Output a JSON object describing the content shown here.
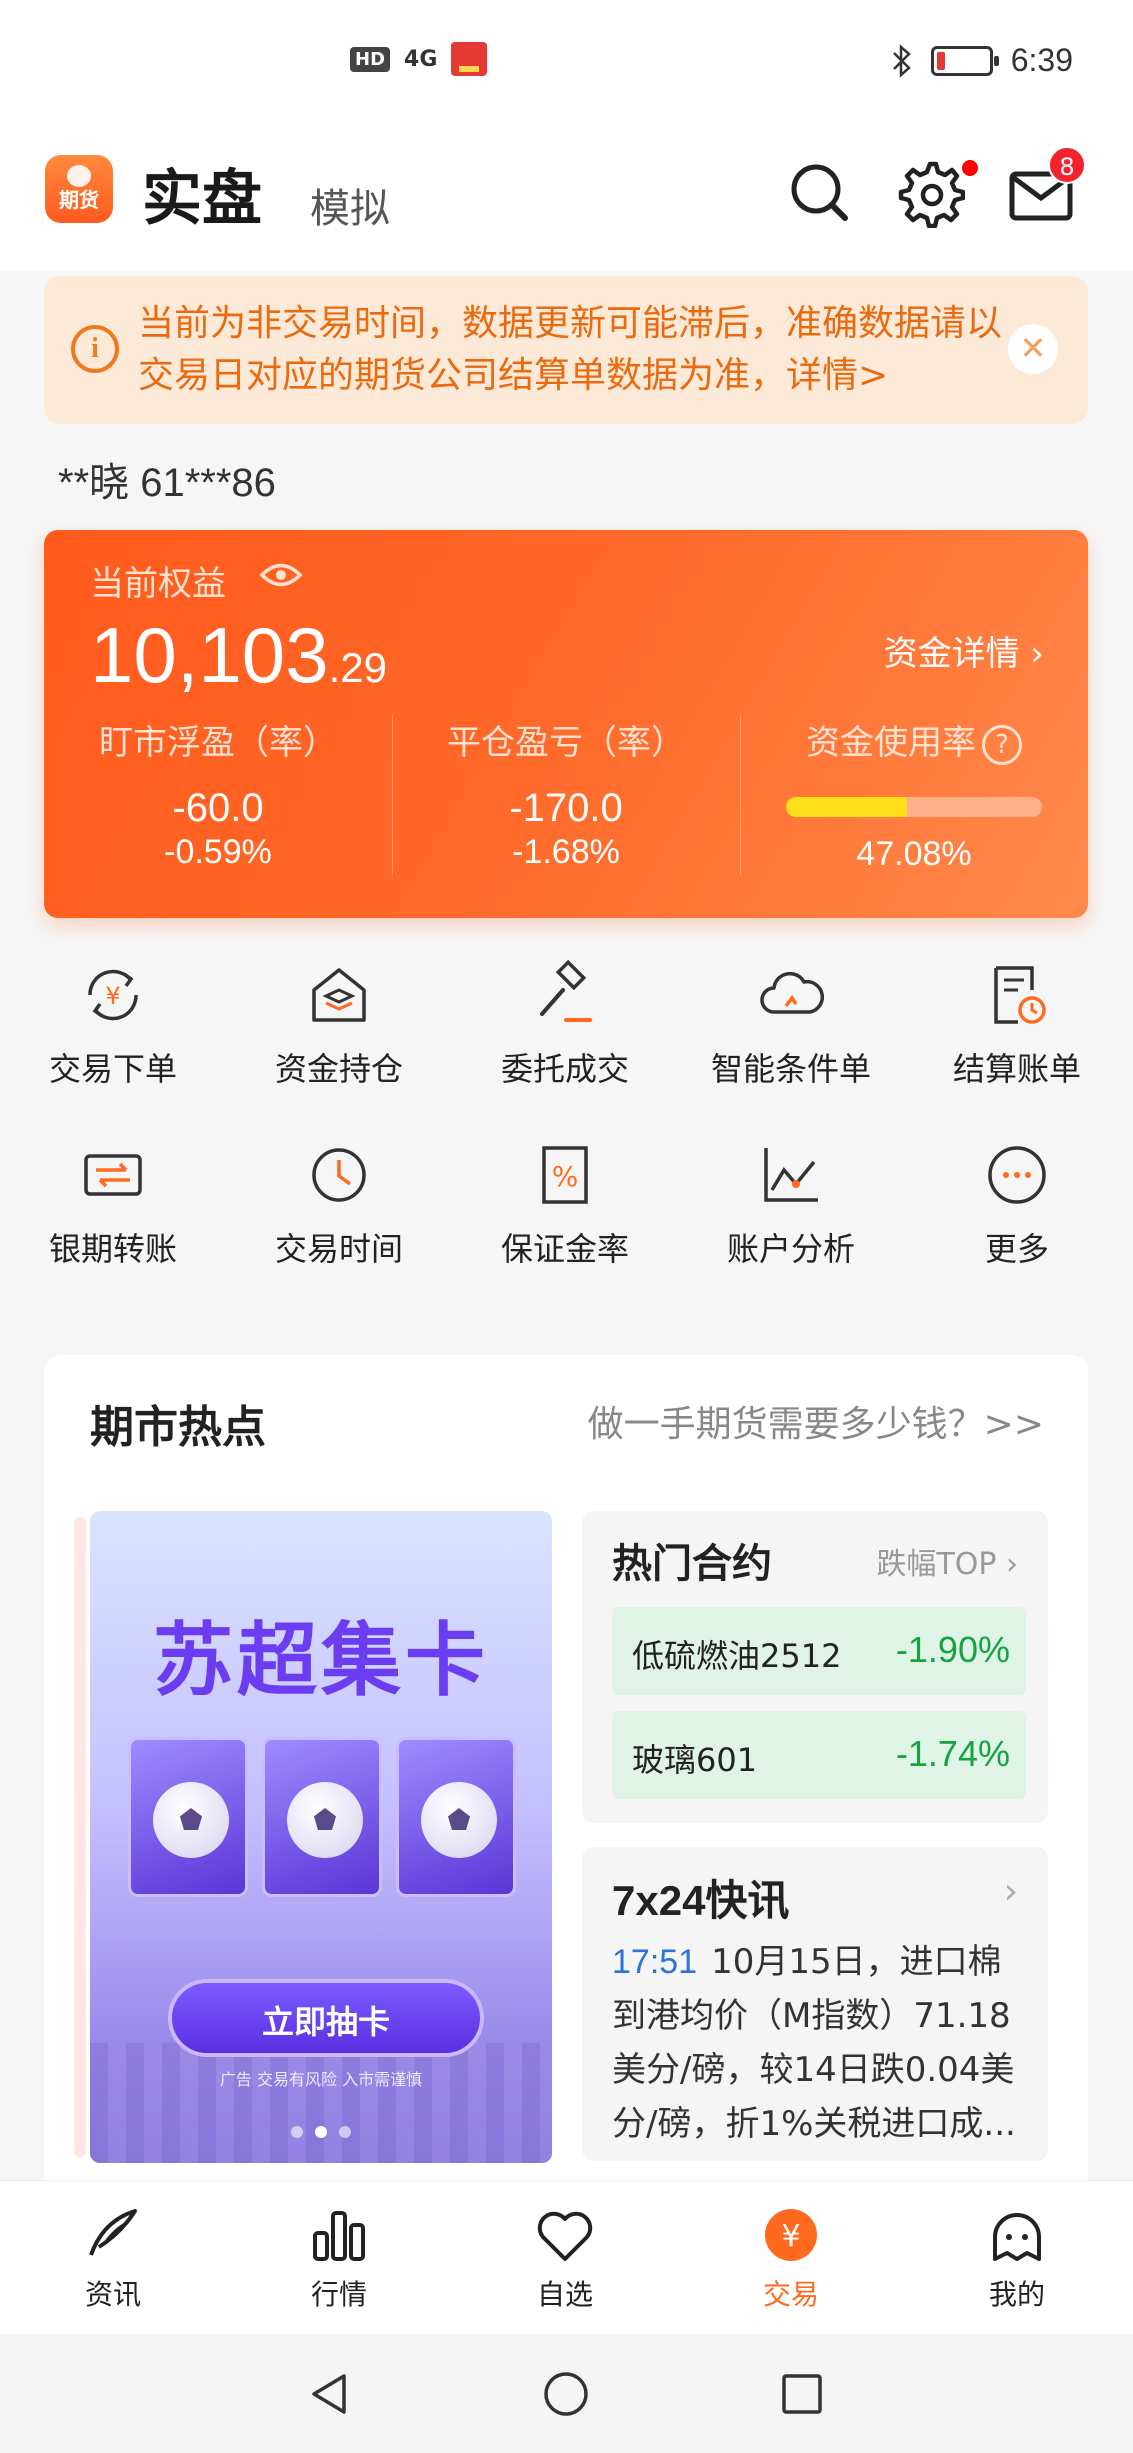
{
  "status_bar": {
    "hd": "HD",
    "signal": "4G",
    "time": "6:39"
  },
  "header": {
    "logo_text": "期货",
    "mode_active": "实盘",
    "mode_inactive": "模拟",
    "mail_badge": "8"
  },
  "notice": {
    "text": "当前为非交易时间，数据更新可能滞后，准确数据请以交易日对应的期货公司结算单数据为准，详情>"
  },
  "account": {
    "name_id": "**晓  61***86"
  },
  "equity": {
    "label": "当前权益",
    "value_int": "10,103",
    "value_dec": ".29",
    "detail_link": "资金详情 ›",
    "stats": [
      {
        "label": "盯市浮盈（率）",
        "v1": "-60.0",
        "v2": "-0.59%"
      },
      {
        "label": "平仓盈亏（率）",
        "v1": "-170.0",
        "v2": "-1.68%"
      },
      {
        "label": "资金使用率",
        "v2": "47.08%"
      }
    ],
    "usage_fraction": 0.4708
  },
  "quick_actions": [
    {
      "label": "交易下单",
      "icon": "yuan-exchange-icon"
    },
    {
      "label": "资金持仓",
      "icon": "house-layers-icon"
    },
    {
      "label": "委托成交",
      "icon": "gavel-icon"
    },
    {
      "label": "智能条件单",
      "icon": "cloud-icon"
    },
    {
      "label": "结算账单",
      "icon": "bill-clock-icon"
    },
    {
      "label": "银期转账",
      "icon": "card-transfer-icon"
    },
    {
      "label": "交易时间",
      "icon": "clock-icon"
    },
    {
      "label": "保证金率",
      "icon": "percent-icon"
    },
    {
      "label": "账户分析",
      "icon": "line-chart-icon"
    },
    {
      "label": "更多",
      "icon": "more-icon"
    }
  ],
  "hot": {
    "title": "期市热点",
    "link": "做一手期货需要多少钱？>>",
    "banner": {
      "title": "苏超集卡",
      "button": "立即抽卡",
      "ad_note": "广告 交易有风险 入市需谨慎"
    },
    "contracts": {
      "title": "热门合约",
      "more": "跌幅TOP ›",
      "rows": [
        {
          "name": "低硫燃油2512",
          "change": "-1.90%"
        },
        {
          "name": "玻璃601",
          "change": "-1.74%"
        }
      ]
    },
    "news": {
      "title": "7x24快讯",
      "arrow": "›",
      "time": "17:51",
      "text": "10月15日，进口棉到港均价（M指数）71.18美分/磅，较14日跌0.04美分/磅，折1%关税进口成..."
    }
  },
  "tabbar": [
    {
      "label": "资讯"
    },
    {
      "label": "行情"
    },
    {
      "label": "自选"
    },
    {
      "label": "交易"
    },
    {
      "label": "我的"
    }
  ],
  "colors": {
    "accent": "#ff6a1f",
    "down_green": "#14a33e",
    "notice_text": "#ea6a10"
  }
}
